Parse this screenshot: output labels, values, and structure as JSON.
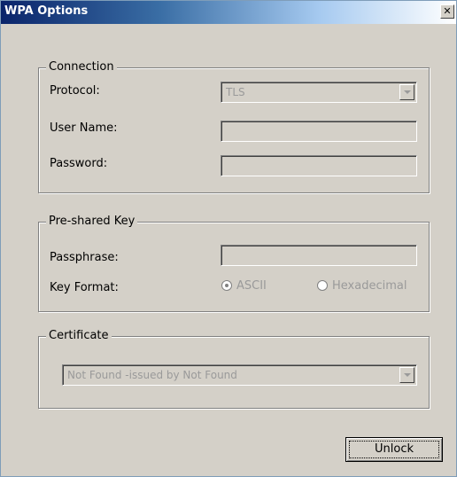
{
  "window": {
    "title": "WPA Options",
    "close_glyph": "✕"
  },
  "connection": {
    "legend": "Connection",
    "protocol_label": "Protocol:",
    "protocol_value": "TLS",
    "username_label": "User Name:",
    "username_value": "",
    "password_label": "Password:",
    "password_value": ""
  },
  "psk": {
    "legend": "Pre-shared Key",
    "passphrase_label": "Passphrase:",
    "passphrase_value": "",
    "key_format_label": "Key Format:",
    "options": [
      "ASCII",
      "Hexadecimal"
    ],
    "selected": "ASCII"
  },
  "certificate": {
    "legend": "Certificate",
    "selected": "Not Found -issued by Not Found"
  },
  "actions": {
    "unlock_label": "Unlock"
  },
  "colors": {
    "title_bar_start": "#0a246a",
    "face": "#d4d0c8",
    "disabled_text": "#9a9a9a"
  }
}
